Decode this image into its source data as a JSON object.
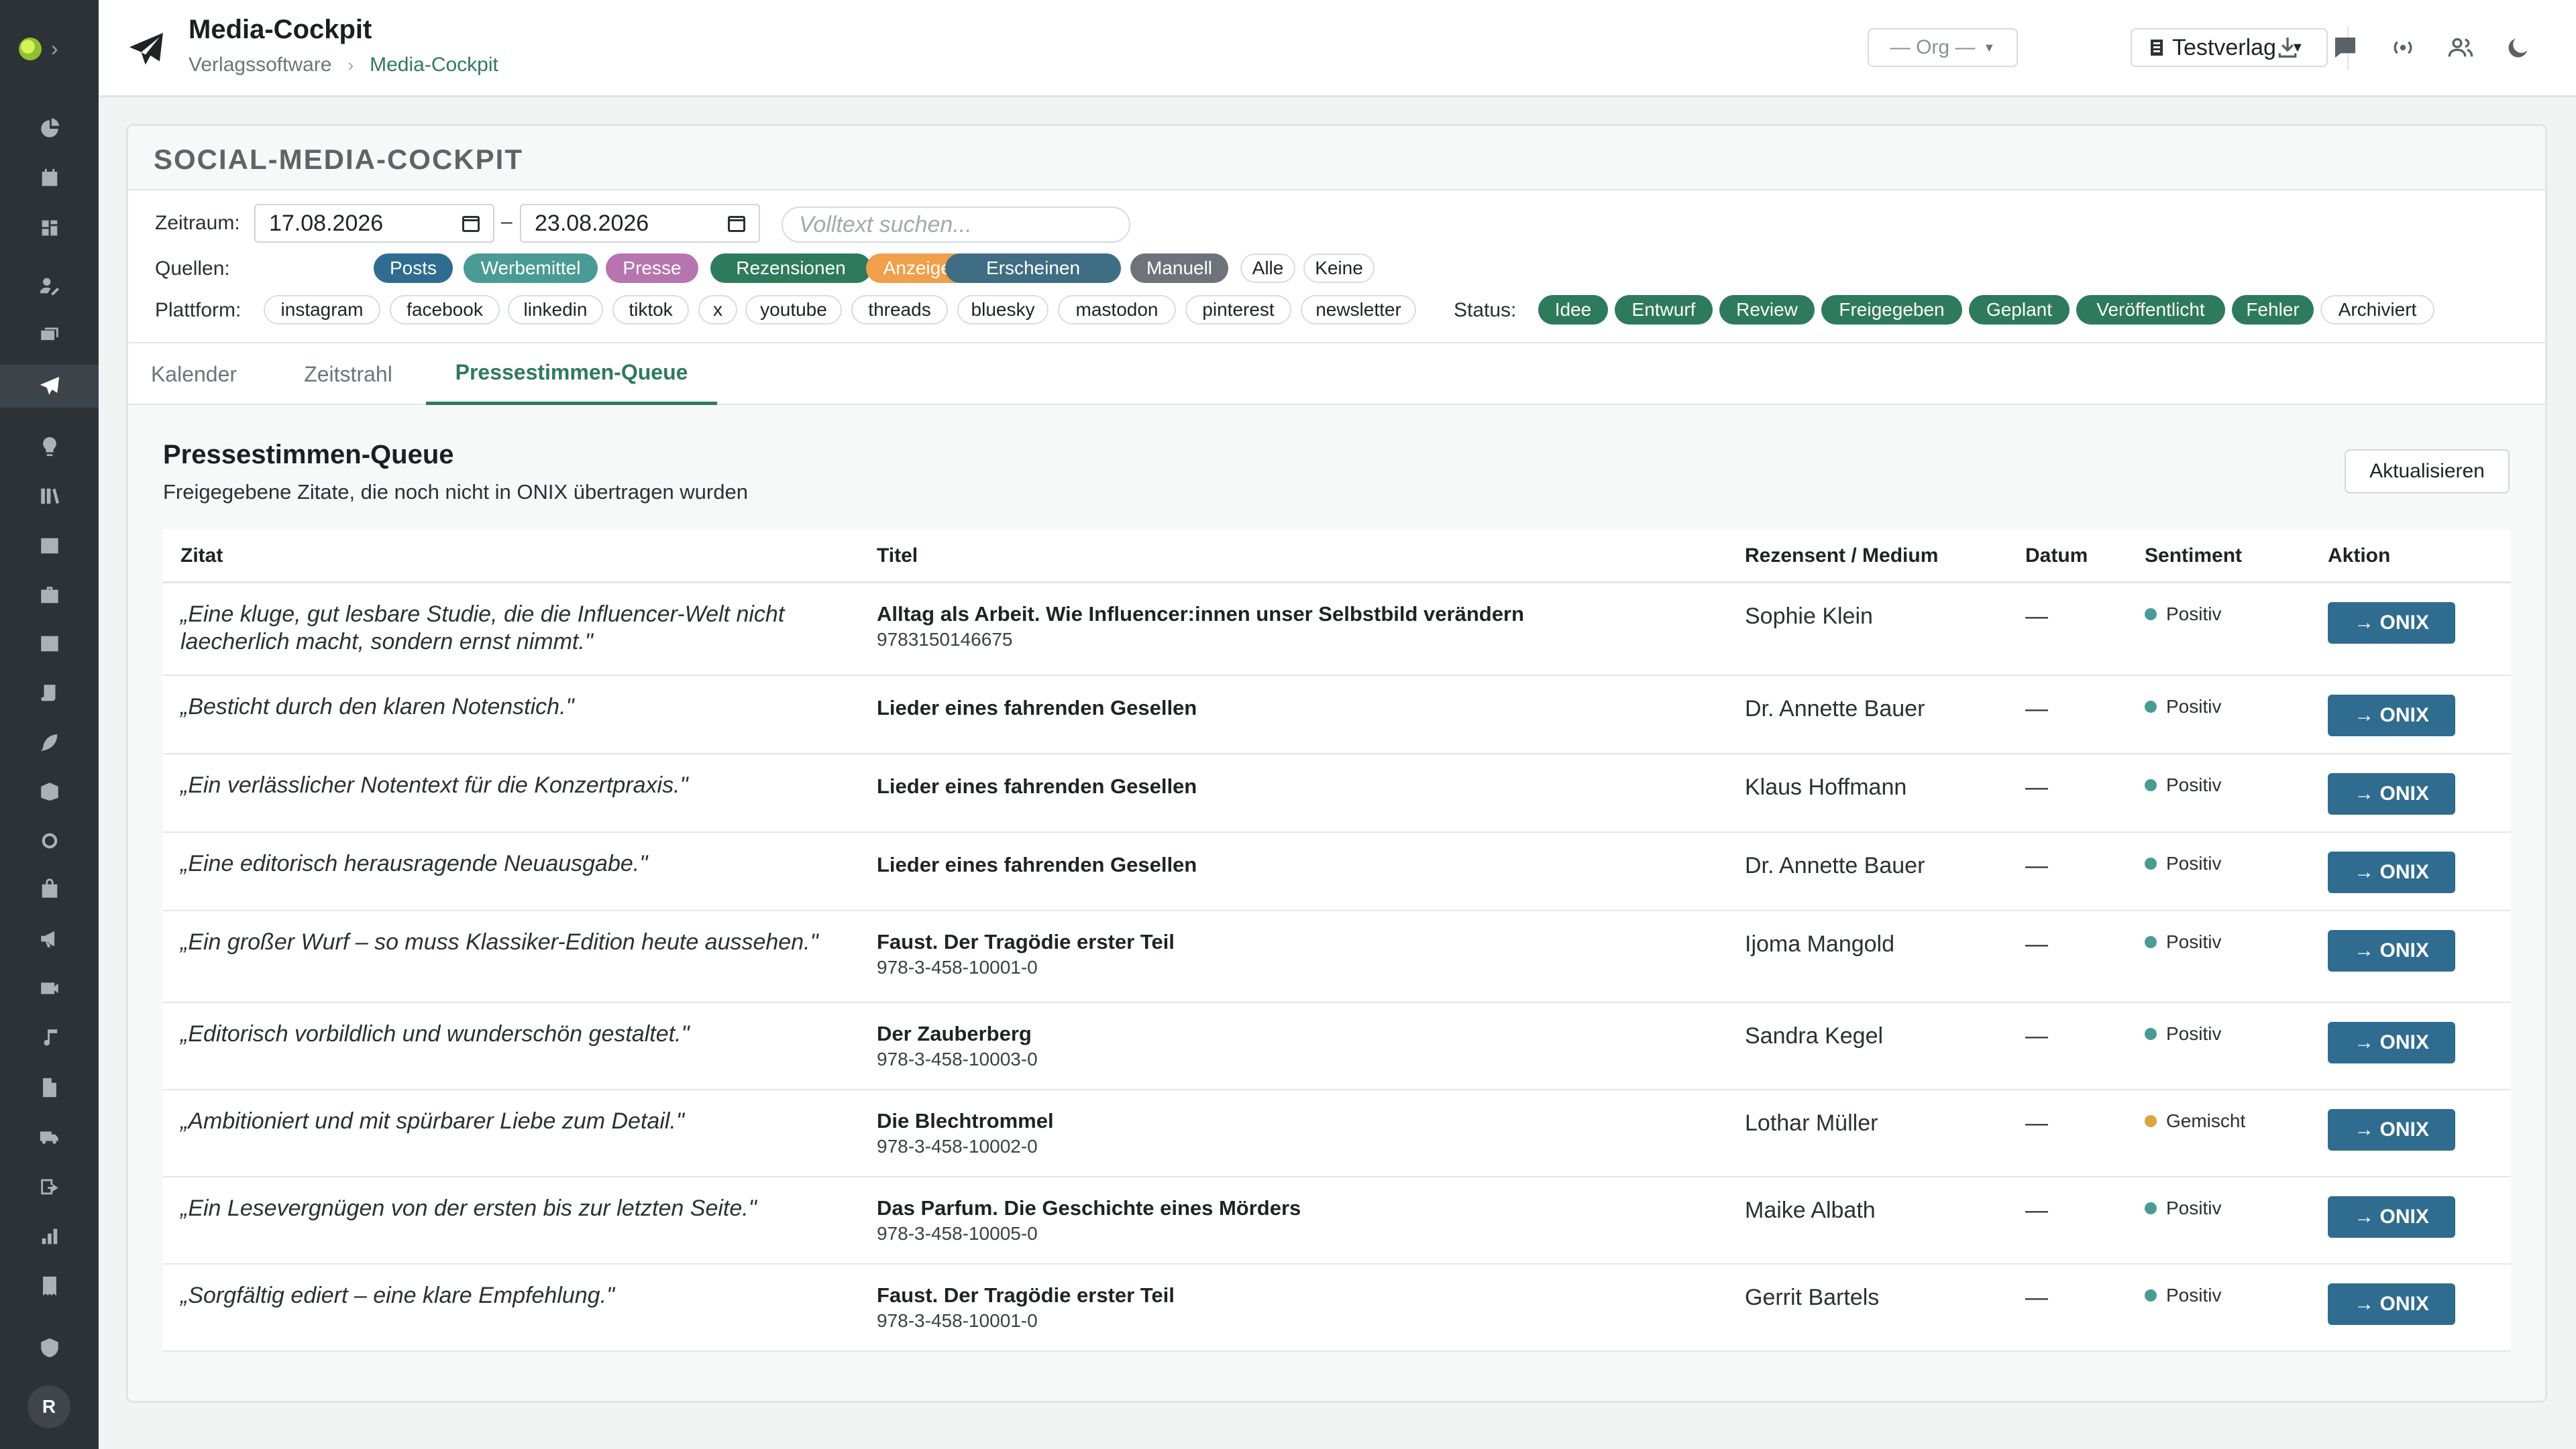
{
  "header": {
    "title": "Media-Cockpit",
    "breadcrumb": [
      "Verlagssoftware",
      "Media-Cockpit"
    ],
    "breadcrumb_sep": "›",
    "org_select": "— Org —",
    "publisher_select": "Testverlag",
    "icons": [
      "download-icon",
      "chat-icon",
      "broadcast-icon",
      "users-icon",
      "moon-icon"
    ]
  },
  "sidebar": {
    "icons": [
      "dashboard-icon",
      "calendar-icon",
      "board-icon",
      "person-edit-icon",
      "layers-icon",
      "paper-plane-icon",
      "lightbulb-icon",
      "library-icon",
      "image-icon",
      "briefcase-icon",
      "media-icon",
      "scroll-icon",
      "feather-icon",
      "box-icon",
      "circle-icon",
      "bag-icon",
      "megaphone-icon",
      "movie-icon",
      "music-icon",
      "document-icon",
      "truck-icon",
      "export-icon",
      "bar-chart-icon",
      "receipt-icon",
      "shield-icon"
    ],
    "active_index": 5,
    "avatar": "R"
  },
  "card": {
    "title": "SOCIAL-MEDIA-COCKPIT",
    "filters": {
      "zeitraum_label": "Zeitraum:",
      "date_from": "17.08.2026",
      "date_sep": "–",
      "date_to": "23.08.2026",
      "search_placeholder": "Volltext suchen...",
      "quellen_label": "Quellen:",
      "quellen": [
        {
          "label": "Posts",
          "color": "#2f6c8f"
        },
        {
          "label": "Werbemittel",
          "color": "#4a9b95"
        },
        {
          "label": "Presse",
          "color": "#b675ae"
        },
        {
          "label": "Rezensionen",
          "color": "#2e7a5c"
        },
        {
          "label": "Anzeigen",
          "color": "#f0a04b"
        },
        {
          "label": "Erscheinen",
          "color": "#3f6d83"
        },
        {
          "label": "Manuell",
          "color": "#6d7378"
        }
      ],
      "quellen_alle": "Alle",
      "quellen_keine": "Keine",
      "plattform_label": "Plattform:",
      "plattformen": [
        "instagram",
        "facebook",
        "linkedin",
        "tiktok",
        "x",
        "youtube",
        "threads",
        "bluesky",
        "mastodon",
        "pinterest",
        "newsletter"
      ],
      "status_label": "Status:",
      "status": [
        {
          "label": "Idee",
          "active": true
        },
        {
          "label": "Entwurf",
          "active": true
        },
        {
          "label": "Review",
          "active": true
        },
        {
          "label": "Freigegeben",
          "active": true
        },
        {
          "label": "Geplant",
          "active": true
        },
        {
          "label": "Veröffentlicht",
          "active": true
        },
        {
          "label": "Fehler",
          "active": true
        },
        {
          "label": "Archiviert",
          "active": false
        }
      ],
      "status_color": "#2e7a5c"
    },
    "tabs": [
      {
        "label": "Kalender",
        "active": false
      },
      {
        "label": "Zeitstrahl",
        "active": false
      },
      {
        "label": "Pressestimmen-Queue",
        "active": true
      }
    ]
  },
  "queue": {
    "title": "Pressestimmen-Queue",
    "subtitle": "Freigegebene Zitate, die noch nicht in ONIX übertragen wurden",
    "refresh_label": "Aktualisieren",
    "columns": [
      "Zitat",
      "Titel",
      "Rezensent / Medium",
      "Datum",
      "Sentiment",
      "Aktion"
    ],
    "action_label": "→ ONIX",
    "sentiment_colors": {
      "Positiv": "#4a9b95",
      "Gemischt": "#d9a640"
    },
    "rows": [
      {
        "quote": "„Eine kluge, gut lesbare Studie, die die Influencer-Welt nicht laecherlich macht, sondern ernst nimmt.\"",
        "title": "Alltag als Arbeit. Wie Influencer:innen unser Selbstbild verändern",
        "isbn": "9783150146675",
        "reviewer": "Sophie Klein",
        "date": "—",
        "sentiment": "Positiv"
      },
      {
        "quote": "„Besticht durch den klaren Notenstich.\"",
        "title": "Lieder eines fahrenden Gesellen",
        "isbn": "",
        "reviewer": "Dr. Annette Bauer",
        "date": "—",
        "sentiment": "Positiv"
      },
      {
        "quote": "„Ein verlässlicher Notentext für die Konzertpraxis.\"",
        "title": "Lieder eines fahrenden Gesellen",
        "isbn": "",
        "reviewer": "Klaus Hoffmann",
        "date": "—",
        "sentiment": "Positiv"
      },
      {
        "quote": "„Eine editorisch herausragende Neuausgabe.\"",
        "title": "Lieder eines fahrenden Gesellen",
        "isbn": "",
        "reviewer": "Dr. Annette Bauer",
        "date": "—",
        "sentiment": "Positiv"
      },
      {
        "quote": "„Ein großer Wurf – so muss Klassiker-Edition heute aussehen.\"",
        "title": "Faust. Der Tragödie erster Teil",
        "isbn": "978-3-458-10001-0",
        "reviewer": "Ijoma Mangold",
        "date": "—",
        "sentiment": "Positiv"
      },
      {
        "quote": "„Editorisch vorbildlich und wunderschön gestaltet.\"",
        "title": "Der Zauberberg",
        "isbn": "978-3-458-10003-0",
        "reviewer": "Sandra Kegel",
        "date": "—",
        "sentiment": "Positiv"
      },
      {
        "quote": "„Ambitioniert und mit spürbarer Liebe zum Detail.\"",
        "title": "Die Blechtrommel",
        "isbn": "978-3-458-10002-0",
        "reviewer": "Lothar Müller",
        "date": "—",
        "sentiment": "Gemischt"
      },
      {
        "quote": "„Ein Lesevergnügen von der ersten bis zur letzten Seite.\"",
        "title": "Das Parfum. Die Geschichte eines Mörders",
        "isbn": "978-3-458-10005-0",
        "reviewer": "Maike Albath",
        "date": "—",
        "sentiment": "Positiv"
      },
      {
        "quote": "„Sorgfältig ediert – eine klare Empfehlung.\"",
        "title": "Faust. Der Tragödie erster Teil",
        "isbn": "978-3-458-10001-0",
        "reviewer": "Gerrit Bartels",
        "date": "—",
        "sentiment": "Positiv"
      }
    ]
  }
}
